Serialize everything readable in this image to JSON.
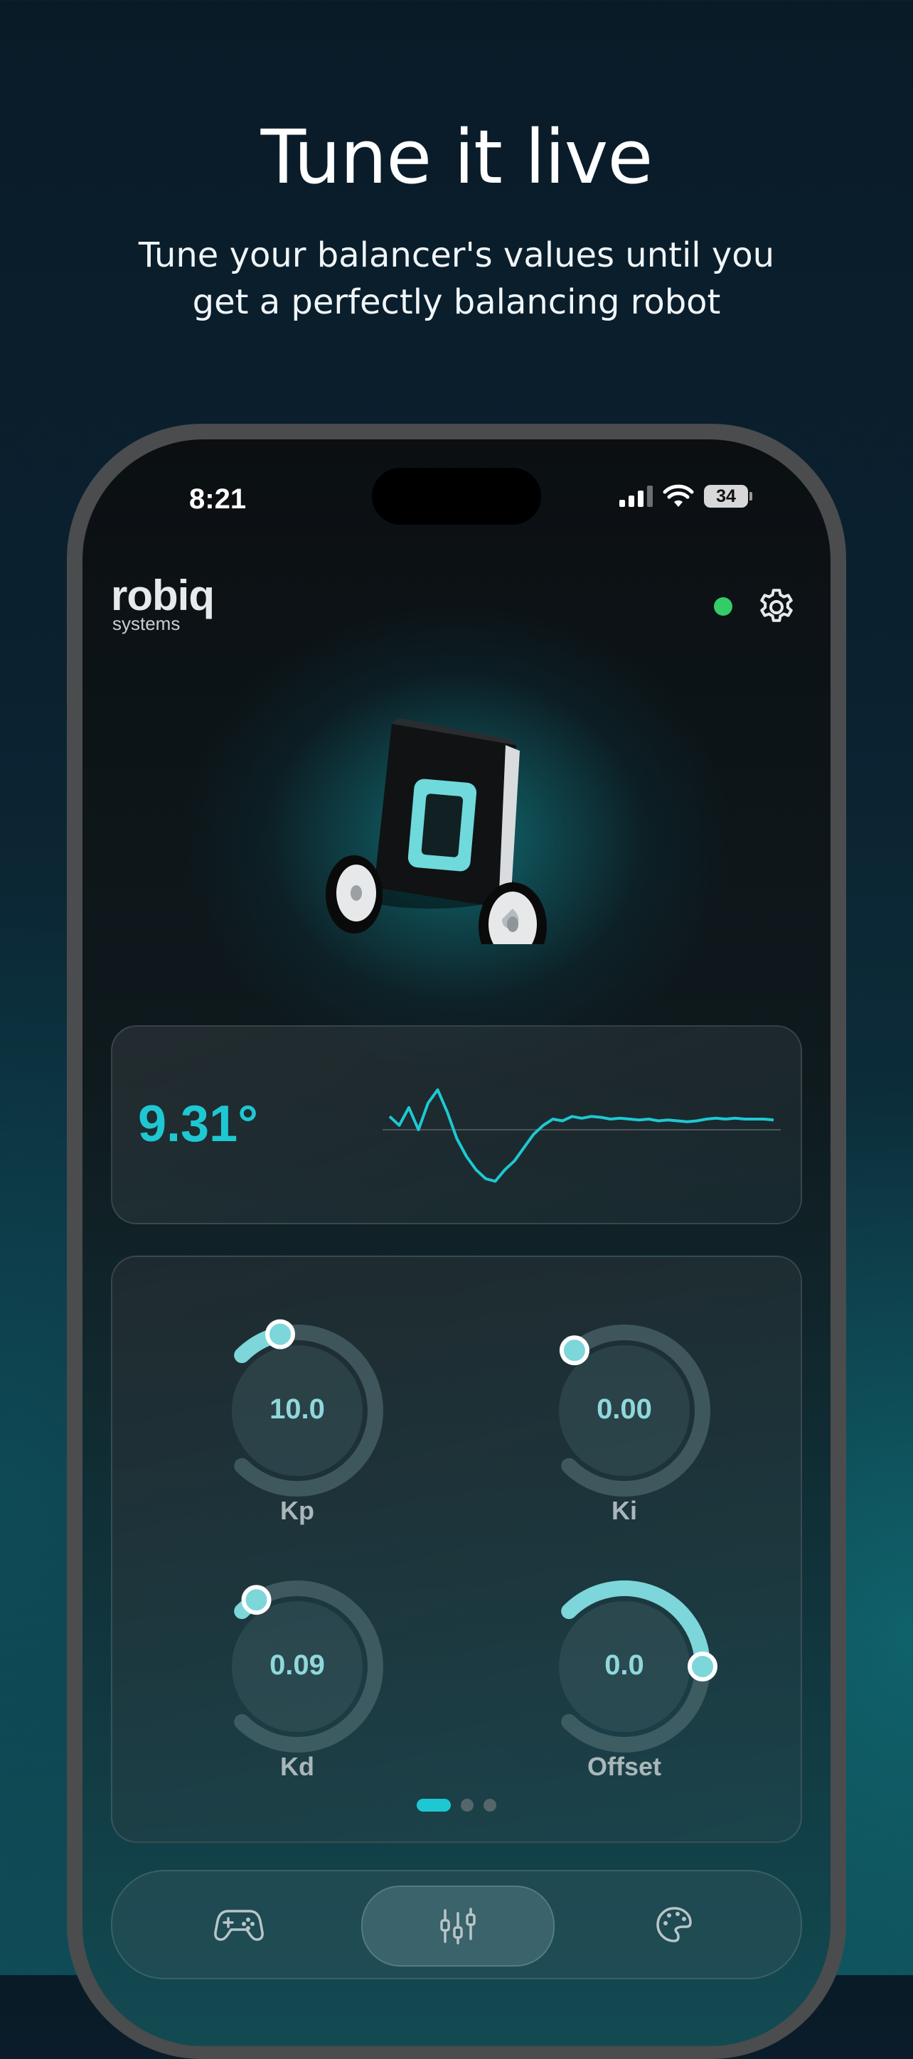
{
  "promo": {
    "headline": "Tune it live",
    "subheadline_line1": "Tune your balancer's values until you",
    "subheadline_line2": "get a perfectly balancing robot"
  },
  "status_bar": {
    "time": "8:21",
    "battery": "34",
    "signal_bars_active": 3,
    "signal_bars_total": 4
  },
  "app": {
    "logo_main": "robiq",
    "logo_sub": "systems",
    "connection_status_color": "#33cc66",
    "settings_icon": "gear-icon"
  },
  "angle": {
    "value": "9.31°",
    "accent_color": "#1ec8d2"
  },
  "chart_data": {
    "type": "line",
    "title": "",
    "xlabel": "",
    "ylabel": "",
    "grid": false,
    "baseline": 0,
    "ylim": [
      -6,
      6
    ],
    "x": [
      0,
      1,
      2,
      3,
      4,
      5,
      6,
      7,
      8,
      9,
      10,
      11,
      12,
      13,
      14,
      15,
      16,
      17,
      18,
      19,
      20,
      21,
      22,
      23,
      24,
      25,
      26,
      27,
      28,
      29,
      30,
      31,
      32,
      33,
      34,
      35,
      36,
      37,
      38,
      39,
      40
    ],
    "series": [
      {
        "values": [
          1.5,
          0.5,
          2.5,
          0,
          3,
          4.5,
          2,
          -1,
          -3,
          -4.5,
          -5.5,
          -5.8,
          -4.5,
          -3.5,
          -2,
          -0.5,
          0.5,
          1.2,
          1.0,
          1.5,
          1.3,
          1.5,
          1.4,
          1.2,
          1.3,
          1.2,
          1.1,
          1.2,
          1.0,
          1.1,
          1.0,
          0.9,
          1.0,
          1.2,
          1.3,
          1.2,
          1.3,
          1.2,
          1.2,
          1.2,
          1.1
        ]
      }
    ]
  },
  "tuning": {
    "knobs": [
      {
        "label": "Kp",
        "value": "10.0",
        "fraction": 0.12
      },
      {
        "label": "Ki",
        "value": "0.00",
        "fraction": 0.02
      },
      {
        "label": "Kd",
        "value": "0.09",
        "fraction": 0.05
      },
      {
        "label": "Offset",
        "value": "0.0",
        "fraction": 0.5
      }
    ],
    "page_count": 3,
    "active_page": 0
  },
  "tabs": [
    {
      "name": "gamepad-icon",
      "active": false
    },
    {
      "name": "tune-sliders-icon",
      "active": true
    },
    {
      "name": "palette-icon",
      "active": false
    }
  ]
}
